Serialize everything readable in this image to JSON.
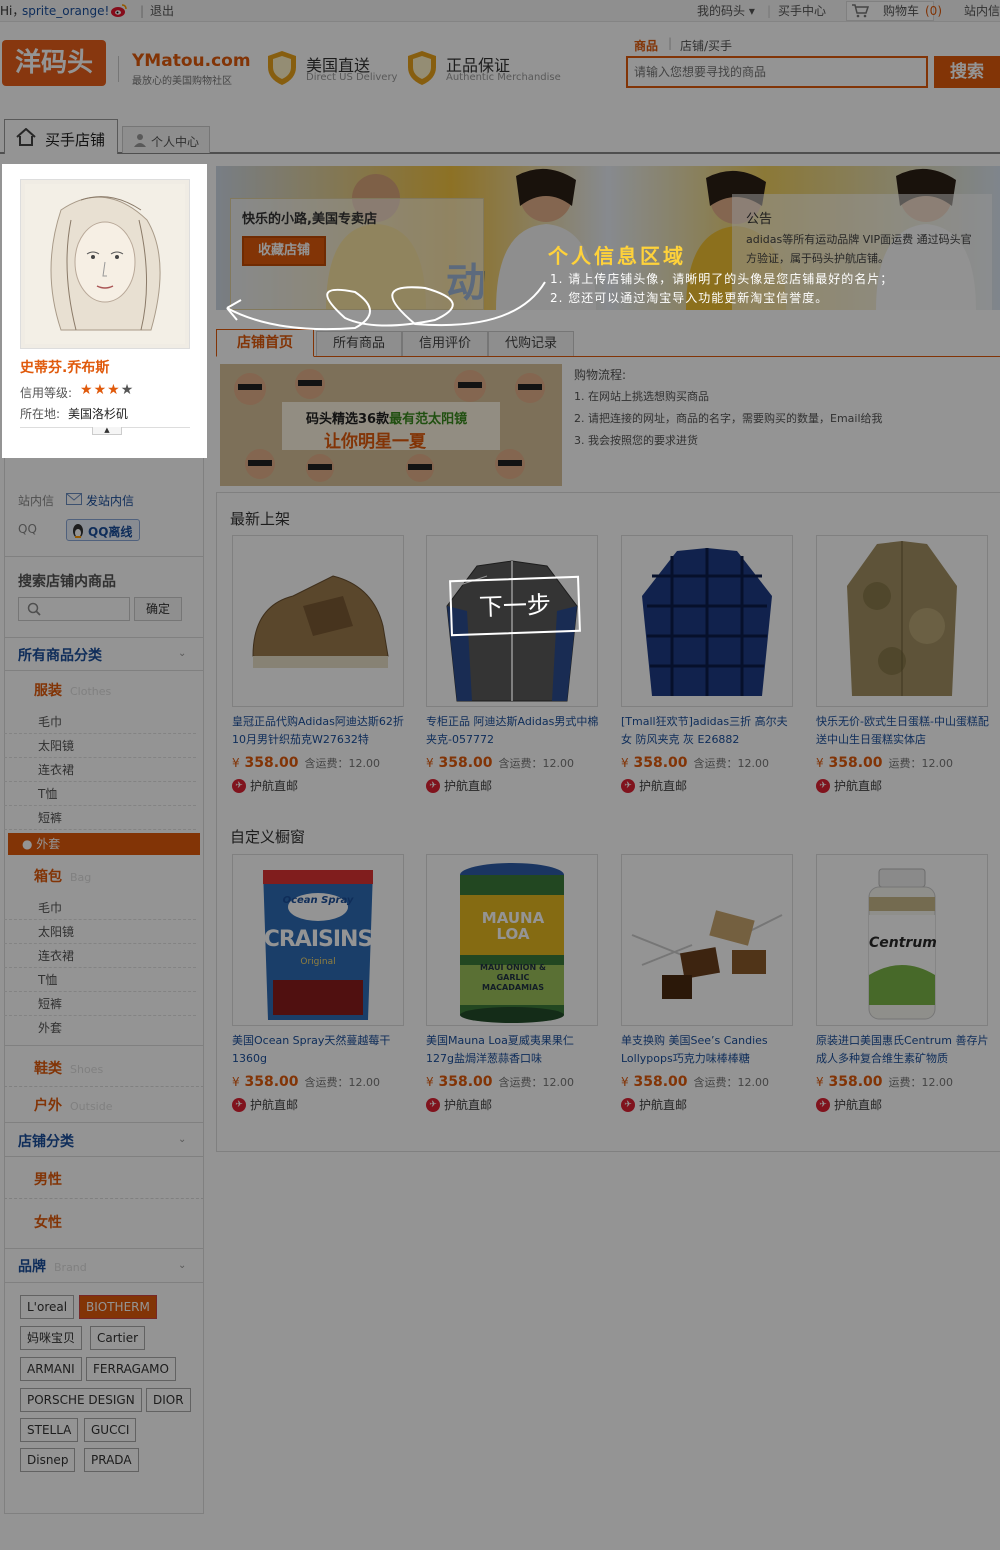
{
  "topbar": {
    "greeting": "Hi，",
    "username": "sprite_orange!",
    "logout": "退出",
    "my_matou": "我的码头 ▾",
    "buyer_center": "买手中心",
    "cart": "购物车",
    "cart_count": "(0)",
    "site_msg": "站内信"
  },
  "header": {
    "logo_cn": "洋码头",
    "logo_en": "YMatou.com",
    "logo_slogan": "最放心的美国购物社区",
    "badge1_title": "美国直送",
    "badge1_sub": "Direct US Delivery",
    "badge2_title": "正品保证",
    "badge2_sub": "Authentic Merchandise",
    "search_tab_active": "商品",
    "search_tab_other": "店铺/买手",
    "search_placeholder": "请输入您想要寻找的商品",
    "search_button": "搜索"
  },
  "nav": {
    "tab_store": "买手店铺",
    "tab_personal": "个人中心"
  },
  "profile": {
    "name": "史蒂芬.乔布斯",
    "credit_label": "信用等级:",
    "stars": 3,
    "location_label": "所在地:",
    "location": "美国洛杉矶"
  },
  "contact": {
    "msg_label": "站内信",
    "msg_action": "发站内信",
    "qq_label": "QQ",
    "qq_action": "QQ离线"
  },
  "search_store": {
    "title": "搜索店铺内商品",
    "button": "确定"
  },
  "all_categories": {
    "title": "所有商品分类",
    "groups": [
      {
        "name": "服装",
        "en": "Clothes",
        "items": [
          "毛巾",
          "太阳镜",
          "连衣裙",
          "T恤",
          "短裤",
          "外套"
        ],
        "active": "外套"
      },
      {
        "name": "箱包",
        "en": "Bag",
        "items": [
          "毛巾",
          "太阳镜",
          "连衣裙",
          "T恤",
          "短裤",
          "外套"
        ]
      },
      {
        "name": "鞋类",
        "en": "Shoes"
      },
      {
        "name": "户外",
        "en": "Outside"
      }
    ]
  },
  "store_categories": {
    "title": "店铺分类",
    "items": [
      "男性",
      "女性"
    ]
  },
  "brands": {
    "title": "品牌",
    "en": "Brand",
    "items": [
      "L'oreal",
      "BIOTHERM",
      "妈咪宝贝",
      "Cartier",
      "ARMANI",
      "FERRAGAMO",
      "PORSCHE DESIGN",
      "DIOR",
      "STELLA",
      "GUCCI",
      "Disnep",
      "PRADA"
    ],
    "active": "BIOTHERM"
  },
  "banner": {
    "store_title": "快乐的小路,美国专卖店",
    "fav_button": "收藏店铺",
    "notice_title": "公告",
    "notice_text": "adidas等所有运动品牌 VIP面运费 通过码头官方验证，属于码头护航店铺。"
  },
  "guide": {
    "title": "个人信息区域",
    "line1": "1. 请上传店铺头像，请晰明了的头像是您店铺最好的名片；",
    "line2": "2. 您还可以通过淘宝导入功能更新淘宝信誉度。",
    "next": "下一步"
  },
  "store_tabs": [
    "店铺首页",
    "所有商品",
    "信用评价",
    "代购记录"
  ],
  "promo": {
    "line1a": "码头精选36款",
    "line1b": "最有范太阳镜",
    "line2": "让你明星一夏"
  },
  "process": {
    "title": "购物流程:",
    "steps": [
      "1. 在网站上挑选想购买商品",
      "2. 请把连接的网址，商品的名字，需要购买的数量，Email给我",
      "3. 我会按照您的要求进货"
    ]
  },
  "new_arrivals": {
    "title": "最新上架",
    "products": [
      {
        "title": "皇冠正品代购Adidas阿迪达斯62折10月男针织茄克W27632特",
        "price": "358.00",
        "ship": "含运费：12.00",
        "badge": "护航直邮"
      },
      {
        "title": "专柜正品 阿迪达斯Adidas男式中棉夹克-057772",
        "price": "358.00",
        "ship": "含运费：12.00",
        "badge": "护航直邮"
      },
      {
        "title": "[Tmall狂欢节]adidas三折 高尔夫 女 防风夹克 灰 E26882",
        "price": "358.00",
        "ship": "含运费：12.00",
        "badge": "护航直邮"
      },
      {
        "title": "快乐无价-欧式生日蛋糕-中山蛋糕配送中山生日蛋糕实体店",
        "price": "358.00",
        "ship": "运费：12.00",
        "badge": "护航直邮"
      }
    ]
  },
  "custom_window": {
    "title": "自定义橱窗",
    "products": [
      {
        "title": "美国Ocean Spray天然蔓越莓干1360g",
        "price": "358.00",
        "ship": "含运费：12.00",
        "badge": "护航直邮"
      },
      {
        "title": "美国Mauna Loa夏威夷果果仁127g盐焗洋葱蒜香口味",
        "price": "358.00",
        "ship": "含运费：12.00",
        "badge": "护航直邮"
      },
      {
        "title": "单支换购 美国See’s Candies Lollypops巧克力味棒棒糖",
        "price": "358.00",
        "ship": "含运费：12.00",
        "badge": "护航直邮"
      },
      {
        "title": "原装进口美国惠氏Centrum 善存片 成人多种复合维生素矿物质",
        "price": "358.00",
        "ship": "运费：12.00",
        "badge": "护航直邮"
      }
    ]
  },
  "product_labels": {
    "craisins": "CRAISINS",
    "craisins_brand": "Ocean Spray",
    "craisins_sub": "Original",
    "mauna": "MAUNA LOA",
    "mauna_sub": "MAUI ONION & GARLIC MACADAMIAS",
    "centrum": "Centrum"
  },
  "currency": "¥",
  "colors": {
    "accent": "#e05a0c",
    "link": "#1a4f9c",
    "guide_yellow": "#ffd23a"
  }
}
